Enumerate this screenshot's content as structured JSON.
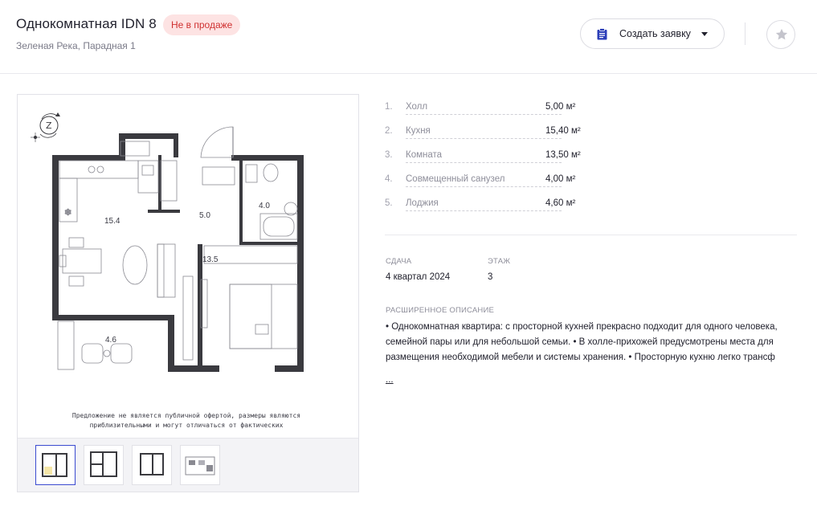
{
  "header": {
    "title": "Однокомнатная IDN 8",
    "status_badge": "Не в продаже",
    "subtitle": "Зеленая Река, Парадная 1",
    "order_button_label": "Создать заявку"
  },
  "plan": {
    "room_labels": {
      "kitchen": "15.4",
      "hall": "5.0",
      "bathroom": "4.0",
      "room": "13.5",
      "loggia": "4.6"
    },
    "disclaimer_line1": "Предложение не является публичной офертой, размеры являются",
    "disclaimer_line2": "приблизительными и могут отличаться от фактических"
  },
  "rooms": [
    {
      "num": "1.",
      "name": "Холл",
      "area": "5,00 м²"
    },
    {
      "num": "2.",
      "name": "Кухня",
      "area": "15,40 м²"
    },
    {
      "num": "3.",
      "name": "Комната",
      "area": "13,50 м²"
    },
    {
      "num": "4.",
      "name": "Совмещенный санузел",
      "area": "4,00 м²"
    },
    {
      "num": "5.",
      "name": "Лоджия",
      "area": "4,60 м²"
    }
  ],
  "details": {
    "delivery_label": "СДАЧА",
    "delivery_value": "4 квартал 2024",
    "floor_label": "ЭТАЖ",
    "floor_value": "3"
  },
  "description": {
    "label": "РАСШИРЕННОЕ ОПИСАНИЕ",
    "text": "• Однокомнатная квартира: с просторной кухней прекрасно подходит для одного человека, семейной пары или для небольшой семьи. • В холле-прихожей предусмотрены места для размещения необходимой мебели и системы хранения. • Просторную кухню легко трансф",
    "more": "..."
  },
  "icons": {
    "order": "clipboard-icon",
    "favorite": "star-icon",
    "dropdown": "caret-down-icon",
    "compass": "compass-icon"
  },
  "colors": {
    "badge_bg": "#fde3e3",
    "badge_text": "#cf3030",
    "accent": "#3b4bd0",
    "wall": "#3a3a3f"
  }
}
